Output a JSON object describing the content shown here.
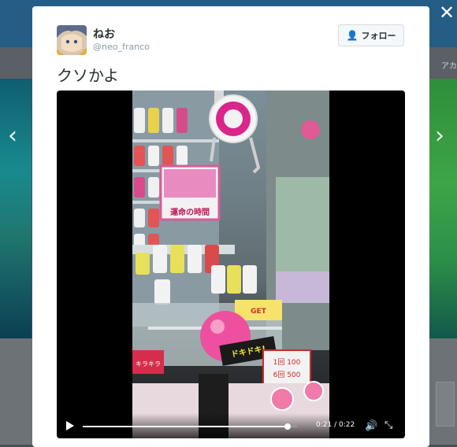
{
  "tweet": {
    "display_name": "ねお",
    "handle": "@neo_franco",
    "text": "クソかよ"
  },
  "follow_button": {
    "label": "フォロー"
  },
  "background": {
    "partial_text": "アカ"
  },
  "video": {
    "time_display": "0:21 / 0:22",
    "progress": 0.955
  },
  "frame_text": {
    "sign_top": "運命の時間",
    "sign_label": "キラキラ",
    "price_a": "1回 100",
    "price_b": "6回 500",
    "get_tag": "GET",
    "price_sign": "ドキドキ!"
  },
  "icons": {
    "close": "close-icon",
    "prev": "chevron-left-icon",
    "next": "chevron-right-icon",
    "follow": "add-user-icon",
    "play": "play-icon",
    "volume": "volume-icon",
    "fullscreen": "fullscreen-icon"
  },
  "colors": {
    "accent": "#55acee",
    "text": "#292f33",
    "muted": "#8899a6"
  }
}
